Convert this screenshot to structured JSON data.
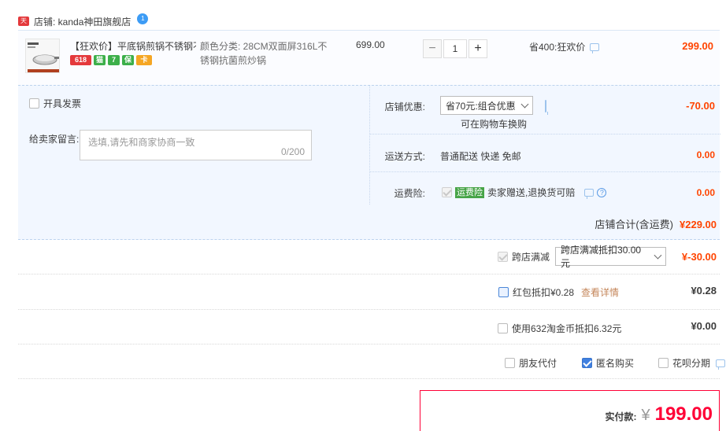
{
  "shop": {
    "badge": "天猫",
    "label": "店铺: kanda神田旗舰店",
    "chat_badge": "1"
  },
  "item": {
    "title": "【狂欢价】平底锅煎锅不锈钢不...",
    "badges": [
      {
        "name": "618-badge",
        "text": "618",
        "color": "#e4393c"
      },
      {
        "name": "tmall-badge",
        "text": "猫",
        "color": "#3caf4a"
      },
      {
        "name": "seven-day-badge",
        "text": "7",
        "color": "#3caf4a"
      },
      {
        "name": "guarantee-badge",
        "text": "保",
        "color": "#3caf4a"
      },
      {
        "name": "card-badge",
        "text": "卡",
        "color": "#f5a623"
      }
    ],
    "sku": "颜色分类: 28CM双面屏316L不锈钢抗菌煎炒锅",
    "unit_price": "699.00",
    "qty_minus": "−",
    "quantity": "1",
    "qty_plus": "+",
    "save_note": "省400:狂欢价",
    "row_total": "299.00"
  },
  "options": {
    "invoice_label": "开具发票",
    "memo_label": "给卖家留言:",
    "memo_placeholder": "选填,请先和商家协商一致",
    "memo_count": "0/200",
    "shop_discount_label": "店铺优惠:",
    "shop_discount_value": "省70元:组合优惠",
    "shop_discount_hint": "可在购物车换购",
    "shop_discount_amount": "-70.00",
    "shipping_label": "运送方式:",
    "shipping_value": "普通配送 快递 免邮",
    "shipping_amount": "0.00",
    "insurance_label": "运费险:",
    "insurance_tag": "运费险",
    "insurance_text": "卖家赠送,退换货可赔",
    "insurance_amount": "0.00"
  },
  "shop_total": {
    "label": "店铺合计(含运费)",
    "amount": "¥229.00"
  },
  "cross_shop": {
    "label": "跨店满减",
    "select_value": "跨店满减抵扣30.00元",
    "amount": "¥-30.00"
  },
  "red_packet": {
    "label": "红包抵扣¥0.28",
    "link": "查看详情",
    "amount": "¥0.28"
  },
  "taojinbi": {
    "label": "使用632淘金币抵扣6.32元",
    "amount": "¥0.00"
  },
  "extras": {
    "friend_pay": "朋友代付",
    "anonymous": "匿名购买",
    "huabei": "花呗分期"
  },
  "payment": {
    "label": "实付款:",
    "currency": "¥",
    "amount": "199.00"
  }
}
